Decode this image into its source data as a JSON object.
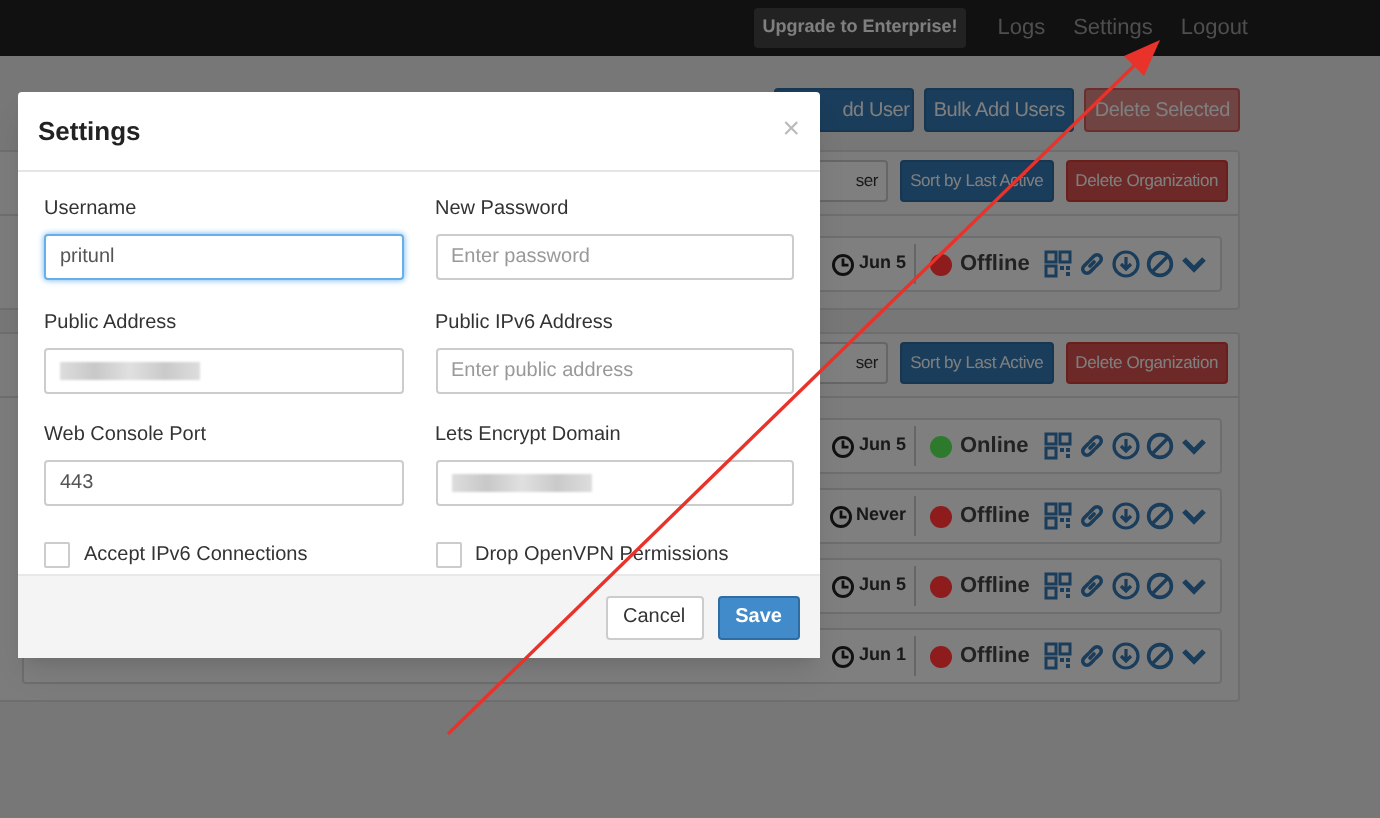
{
  "nav": {
    "badge": "Upgrade to Enterprise!",
    "links": [
      {
        "label": "Logs"
      },
      {
        "label": "Settings"
      },
      {
        "label": "Logout"
      }
    ]
  },
  "toolbar": [
    {
      "label": "dd User",
      "kind": "primary"
    },
    {
      "label": "Bulk Add Users",
      "kind": "primary"
    },
    {
      "label": "Delete Selected",
      "kind": "danger_disabled"
    }
  ],
  "organizations": [
    {
      "buttons": [
        {
          "label": "ser",
          "kind": "default"
        },
        {
          "label": "Sort by Last Active",
          "kind": "primary"
        },
        {
          "label": "Delete Organization",
          "kind": "danger"
        }
      ],
      "users": [
        {
          "last_active": "Jun 5",
          "status": "Offline",
          "color": "#8e1c1c"
        }
      ]
    },
    {
      "buttons": [
        {
          "label": "ser",
          "kind": "default"
        },
        {
          "label": "Sort by Last Active",
          "kind": "primary"
        },
        {
          "label": "Delete Organization",
          "kind": "danger"
        }
      ],
      "users": [
        {
          "last_active": "Jun 5",
          "status": "Online",
          "color": "#2d7a2d"
        },
        {
          "last_active": "Never",
          "status": "Offline",
          "color": "#8e1c1c"
        },
        {
          "last_active": "Jun 5",
          "status": "Offline",
          "color": "#8e1c1c"
        },
        {
          "last_active": "Jun 1",
          "status": "Offline",
          "color": "#8e1c1c"
        }
      ]
    }
  ],
  "modal": {
    "title": "Settings",
    "close": "×",
    "fields": [
      {
        "label": "Username",
        "value": "pritunl",
        "focused": true,
        "redacted": false
      },
      {
        "label": "New Password",
        "placeholder": "Enter password",
        "focused": false,
        "redacted": false
      },
      {
        "label": "Public Address",
        "focused": false,
        "redacted": true
      },
      {
        "label": "Public IPv6 Address",
        "placeholder": "Enter public address",
        "focused": false,
        "redacted": false
      },
      {
        "label": "Web Console Port",
        "value": "443",
        "focused": false,
        "redacted": false
      },
      {
        "label": "Lets Encrypt Domain",
        "focused": false,
        "redacted": true
      }
    ],
    "checkboxes": [
      {
        "label": "Accept IPv6 Connections",
        "checked": false
      },
      {
        "label": "Drop OpenVPN Permissions",
        "checked": false
      }
    ],
    "buttons": [
      {
        "label": "Cancel",
        "kind": "default"
      },
      {
        "label": "Save",
        "kind": "primary"
      }
    ]
  }
}
